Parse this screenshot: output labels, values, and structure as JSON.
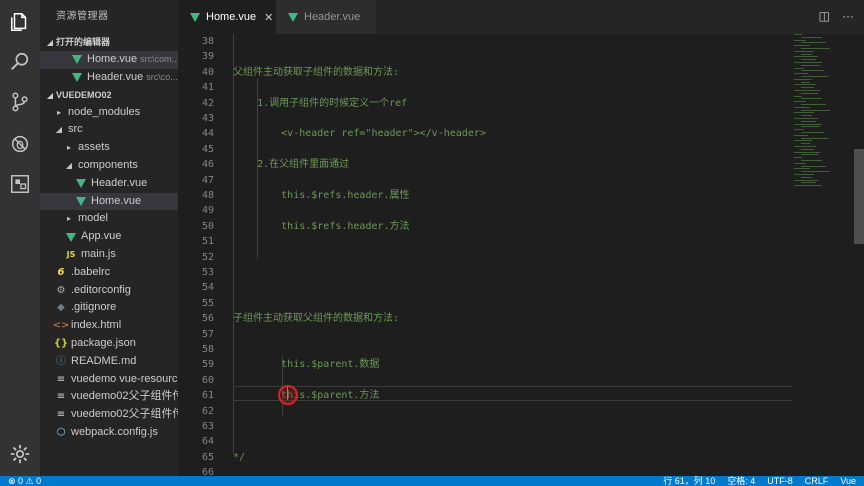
{
  "activity_bar": {
    "icons": [
      "files-icon",
      "search-icon",
      "source-control-icon",
      "debug-icon",
      "extensions-icon"
    ],
    "settings_icon": "gear-icon"
  },
  "sidebar": {
    "title": "资源管理器",
    "open_editors": {
      "label": "打开的编辑器",
      "items": [
        {
          "name": "Home.vue",
          "path": "src\\com..."
        },
        {
          "name": "Header.vue",
          "path": "src\\co..."
        }
      ]
    },
    "project": {
      "label": "VUEDEMO02",
      "tree": [
        {
          "name": "node_modules",
          "type": "folder",
          "expanded": false,
          "depth": 0
        },
        {
          "name": "src",
          "type": "folder",
          "expanded": true,
          "depth": 0
        },
        {
          "name": "assets",
          "type": "folder",
          "expanded": false,
          "depth": 1
        },
        {
          "name": "components",
          "type": "folder",
          "expanded": true,
          "depth": 1
        },
        {
          "name": "Header.vue",
          "type": "vue",
          "depth": 2
        },
        {
          "name": "Home.vue",
          "type": "vue",
          "depth": 2,
          "selected": true
        },
        {
          "name": "model",
          "type": "folder",
          "expanded": false,
          "depth": 1
        },
        {
          "name": "App.vue",
          "type": "vue",
          "depth": 1
        },
        {
          "name": "main.js",
          "type": "js",
          "depth": 1
        },
        {
          "name": ".babelrc",
          "type": "babel",
          "depth": 0
        },
        {
          "name": ".editorconfig",
          "type": "config",
          "depth": 0
        },
        {
          "name": ".gitignore",
          "type": "git",
          "depth": 0
        },
        {
          "name": "index.html",
          "type": "html",
          "depth": 0
        },
        {
          "name": "package.json",
          "type": "json",
          "depth": 0
        },
        {
          "name": "README.md",
          "type": "info",
          "depth": 0
        },
        {
          "name": "vuedemo vue-resourc...",
          "type": "text",
          "depth": 0
        },
        {
          "name": "vuedemo02父子组件传...",
          "type": "text",
          "depth": 0
        },
        {
          "name": "vuedemo02父子组件传...",
          "type": "text",
          "depth": 0
        },
        {
          "name": "webpack.config.js",
          "type": "webpack",
          "depth": 0
        }
      ]
    }
  },
  "tabs": [
    {
      "label": "Home.vue",
      "active": true,
      "close": "✕"
    },
    {
      "label": "Header.vue",
      "active": false
    }
  ],
  "editor": {
    "lines": [
      {
        "n": "38",
        "text": ""
      },
      {
        "n": "39",
        "text": ""
      },
      {
        "n": "40",
        "text": "父组件主动获取子组件的数据和方法:"
      },
      {
        "n": "41",
        "text": ""
      },
      {
        "n": "42",
        "text": "    1.调用子组件的时候定义一个ref"
      },
      {
        "n": "43",
        "text": ""
      },
      {
        "n": "44",
        "text": "        <v-header ref=\"header\"></v-header>"
      },
      {
        "n": "45",
        "text": ""
      },
      {
        "n": "46",
        "text": "    2.在父组件里面通过"
      },
      {
        "n": "47",
        "text": ""
      },
      {
        "n": "48",
        "text": "        this.$refs.header.属性"
      },
      {
        "n": "49",
        "text": ""
      },
      {
        "n": "50",
        "text": "        this.$refs.header.方法"
      },
      {
        "n": "51",
        "text": ""
      },
      {
        "n": "52",
        "text": ""
      },
      {
        "n": "53",
        "text": ""
      },
      {
        "n": "54",
        "text": ""
      },
      {
        "n": "55",
        "text": ""
      },
      {
        "n": "56",
        "text": "子组件主动获取父组件的数据和方法:"
      },
      {
        "n": "57",
        "text": ""
      },
      {
        "n": "58",
        "text": ""
      },
      {
        "n": "59",
        "text": "        this.$parent.数据"
      },
      {
        "n": "60",
        "text": ""
      },
      {
        "n": "61",
        "text": "        this.$parent.方法"
      },
      {
        "n": "62",
        "text": ""
      },
      {
        "n": "63",
        "text": ""
      },
      {
        "n": "64",
        "text": ""
      },
      {
        "n": "65",
        "text": "*/"
      },
      {
        "n": "66",
        "text": ""
      }
    ]
  },
  "statusbar": {
    "left": "⊗ 0  ⚠ 0",
    "position": "行 61，列 10",
    "spaces": "空格: 4",
    "encoding": "UTF-8",
    "eol": "CRLF",
    "language": "Vue"
  },
  "colors": {
    "accent": "#007acc",
    "vue_green": "#41b883",
    "comment_green": "#6a9955"
  }
}
